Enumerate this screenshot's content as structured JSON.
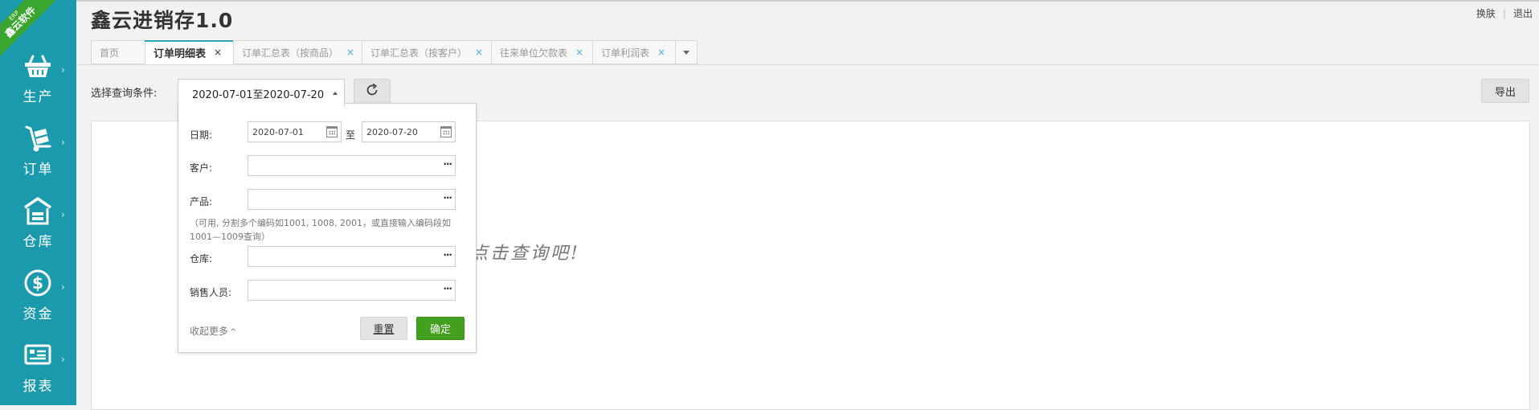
{
  "sidebar": {
    "ribbon": {
      "small": "ERP",
      "brand": "鑫云软件"
    },
    "items": [
      {
        "label": "生产"
      },
      {
        "label": "订单"
      },
      {
        "label": "仓库"
      },
      {
        "label": "资金"
      },
      {
        "label": "报表"
      }
    ]
  },
  "header": {
    "title": "鑫云进销存1.0",
    "skin_label": "换肤",
    "logout_label": "退出"
  },
  "tabs": [
    {
      "label": "首页"
    },
    {
      "label": "订单明细表"
    },
    {
      "label": "订单汇总表（按商品）"
    },
    {
      "label": "订单汇总表（按客户）"
    },
    {
      "label": "往来单位欠款表"
    },
    {
      "label": "订单利润表"
    }
  ],
  "tab_close_glyph": "×",
  "query": {
    "label": "选择查询条件:",
    "selected": "2020-07-01至2020-07-20",
    "export_label": "导出"
  },
  "filter": {
    "date_label": "日期:",
    "date_from": "2020-07-01",
    "to_label": "至",
    "date_to": "2020-07-20",
    "customer_label": "客户:",
    "product_label": "产品:",
    "product_note": "（可用, 分割多个编码如1001, 1008, 2001，或直接输入编码段如1001—1009查询）",
    "warehouse_label": "仓库:",
    "salesperson_label": "销售人员:",
    "more_glyph": "···",
    "collapse_label": "收起更多",
    "reset_label": "重置",
    "confirm_label": "确定"
  },
  "empty_hint": "点击查询吧!",
  "colors": {
    "sidebar": "#1b9aae",
    "ribbon": "#3aa52f",
    "confirm": "#43a01f",
    "tab_accent": "#2aa7c0"
  }
}
